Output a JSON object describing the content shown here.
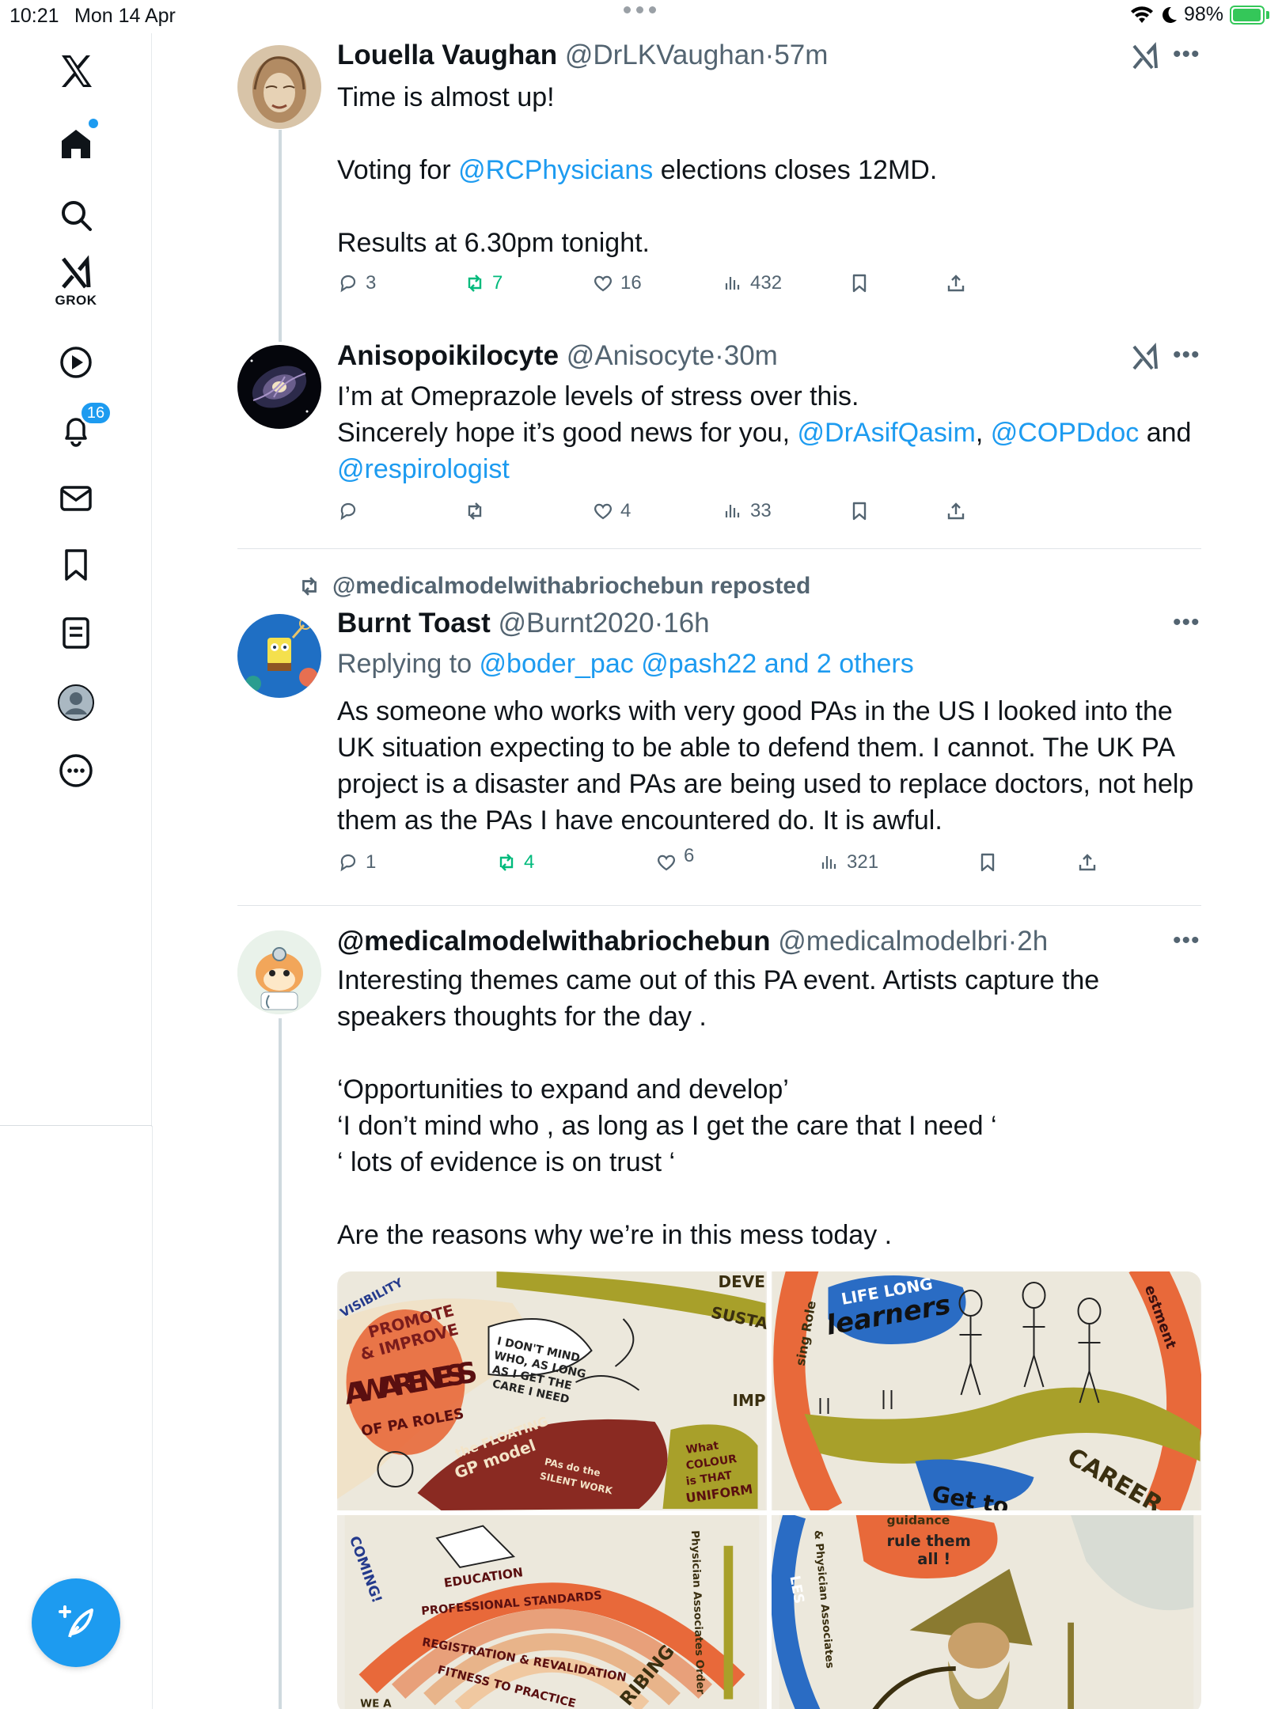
{
  "status_bar": {
    "time": "10:21",
    "date": "Mon 14 Apr",
    "battery": "98%",
    "battery_level": 0.98
  },
  "sidebar": {
    "grok_label": "GROK",
    "notifications_count": "16",
    "items": [
      "x-logo",
      "home",
      "search",
      "grok",
      "videos",
      "notifications",
      "messages",
      "bookmarks",
      "lists",
      "profile",
      "more"
    ]
  },
  "tweets": [
    {
      "name": "Louella Vaughan",
      "handle": "@DrLKVaughan",
      "time": "57m",
      "lines": [
        [
          "Time is almost up!"
        ],
        [
          ""
        ],
        [
          "Voting for ",
          {
            "link": "@RCPhysicians"
          },
          " elections closes 12MD."
        ],
        [
          ""
        ],
        [
          "Results at 6.30pm tonight."
        ]
      ],
      "replies": "3",
      "reposts": "7",
      "likes": "16",
      "views": "432"
    },
    {
      "name": "Anisopoikilocyte",
      "handle": "@Anisocyte",
      "time": "30m",
      "lines": [
        [
          "I’m at Omeprazole levels of stress over this."
        ],
        [
          "Sincerely hope it’s good news for you, ",
          {
            "link": "@DrAsifQasim"
          },
          ", ",
          {
            "link": "@COPDdoc"
          },
          " and"
        ],
        [
          {
            "link": "@respirologist"
          }
        ]
      ],
      "replies": "",
      "reposts": "",
      "likes": "4",
      "views": "33"
    },
    {
      "repost_by": "@medicalmodelwithabriochebun reposted",
      "name": "Burnt Toast",
      "handle": "@Burnt2020",
      "time": "16h",
      "replying_prefix": "Replying to ",
      "replying_links": "@boder_pac @pash22 and 2 others",
      "lines": [
        [
          "As someone who works with very good PAs in the US I looked into the"
        ],
        [
          "UK situation expecting to be able to defend them. I cannot. The UK PA"
        ],
        [
          "project is a disaster and PAs are being used to replace doctors, not help"
        ],
        [
          "them as the PAs I have encountered do. It is awful."
        ]
      ],
      "replies": "1",
      "reposts": "4",
      "likes": "6",
      "views": "321"
    },
    {
      "name": "@medicalmodelwithabriochebun",
      "handle": "@medicalmodelbri",
      "time": "2h",
      "lines": [
        [
          "Interesting themes came out of this PA event. Artists capture the"
        ],
        [
          "speakers thoughts for the day ."
        ],
        [
          ""
        ],
        [
          "‘Opportunities to expand and develop’"
        ],
        [
          "‘I don’t mind who , as long as I get the care that I need ‘"
        ],
        [
          "‘ lots of evidence is on trust ‘"
        ],
        [
          ""
        ],
        [
          "Are the reasons why we’re in this mess today ."
        ]
      ]
    }
  ],
  "media_text": {
    "img1": [
      "VISIBILITY",
      "PROMOTE",
      "& IMPROVE",
      "AWARENESS",
      "OF PA ROLES",
      "I DON'T MIND",
      "WHO, AS LONG",
      "AS I GET THE",
      "CARE I NEED",
      "SUSTAIN",
      "DEVE",
      "the FLOATING",
      "GP model",
      "PAs do the",
      "SILENT WORK",
      "What",
      "COLOUR",
      "is THAT",
      "UNIFORM",
      "IMP"
    ],
    "img2": [
      "LIFE LONG",
      "learners",
      "CAREER",
      "Get to",
      "estment",
      "sing Role"
    ],
    "img3": [
      "COMING!",
      "EDUCATION",
      "PROFESSIONAL STANDARDS",
      "REGISTRATION & REVALIDATION",
      "FITNESS TO PRACTICE",
      "Physician Associates Order",
      "RIBING",
      "WE A"
    ],
    "img4": [
      "guidance",
      "rule them",
      "all !",
      "& Physician Associates",
      "LES"
    ]
  },
  "colors": {
    "accent": "#1d9bf0",
    "repost_green": "#00ba7c",
    "muted": "#536471",
    "battery_green": "#34c759"
  }
}
